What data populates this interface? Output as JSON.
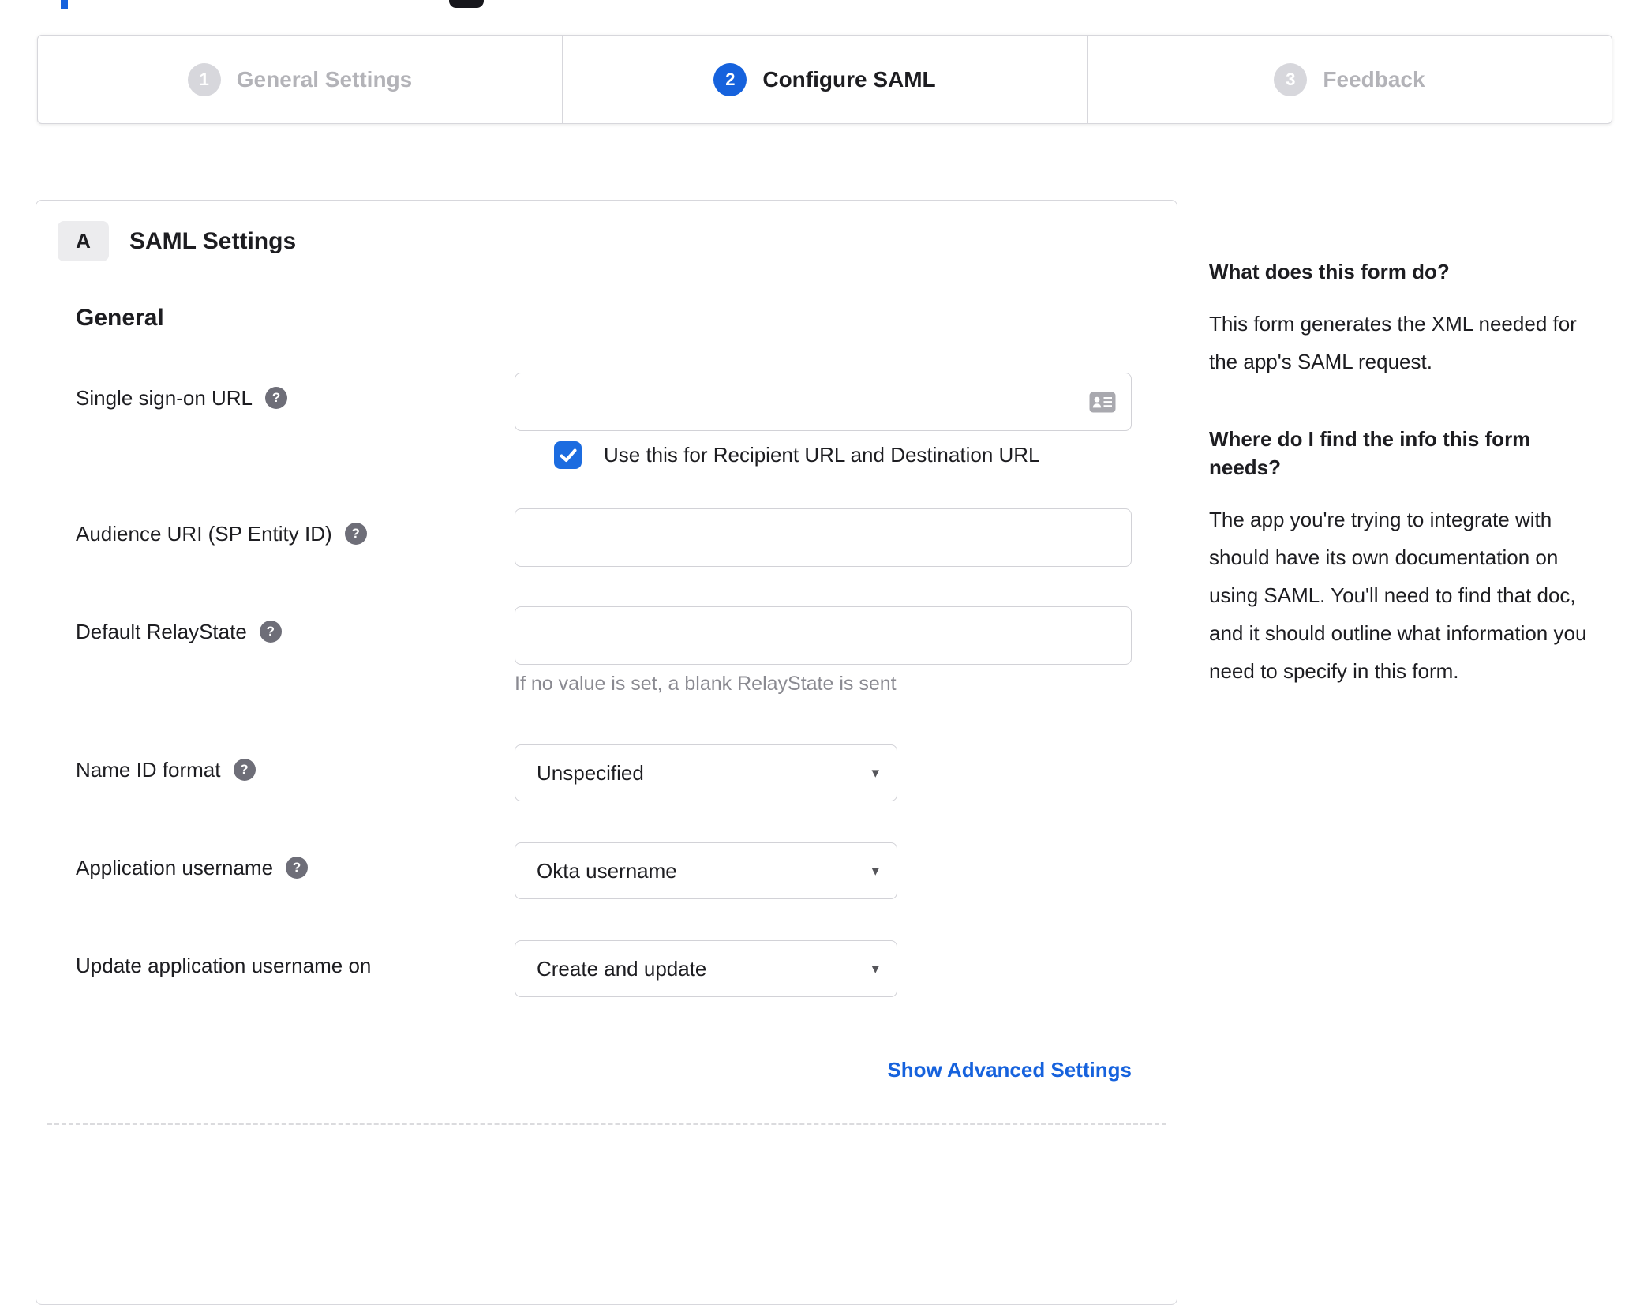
{
  "stepper": {
    "steps": [
      {
        "number": "1",
        "label": "General Settings",
        "state": "inactive"
      },
      {
        "number": "2",
        "label": "Configure SAML",
        "state": "active"
      },
      {
        "number": "3",
        "label": "Feedback",
        "state": "inactive"
      }
    ]
  },
  "panel": {
    "section_badge": "A",
    "section_title": "SAML Settings",
    "group_heading": "General",
    "fields": {
      "sso": {
        "label": "Single sign-on URL",
        "value": "",
        "checkbox_label": "Use this for Recipient URL and Destination URL",
        "checkbox_checked": true
      },
      "audience": {
        "label": "Audience URI (SP Entity ID)",
        "value": ""
      },
      "relay": {
        "label": "Default RelayState",
        "value": "",
        "hint": "If no value is set, a blank RelayState is sent"
      },
      "name_id": {
        "label": "Name ID format",
        "value": "Unspecified"
      },
      "app_username": {
        "label": "Application username",
        "value": "Okta username"
      },
      "update_on": {
        "label": "Update application username on",
        "value": "Create and update"
      }
    },
    "advanced_link": "Show Advanced Settings"
  },
  "sidebar": {
    "blocks": [
      {
        "heading": "What does this form do?",
        "body": "This form generates the XML needed for the app's SAML request."
      },
      {
        "heading": "Where do I find the info this form needs?",
        "body": "The app you're trying to integrate with should have its own documentation on using SAML. You'll need to find that doc, and it should outline what information you need to specify in this form."
      }
    ]
  },
  "glyphs": {
    "help": "?",
    "caret": "▾"
  },
  "icons": [
    "help-icon",
    "contact-card-icon",
    "checkmark-icon",
    "caret-down-icon"
  ],
  "colors": {
    "accent": "#1662dd",
    "checkbox": "#1c6ce0",
    "border": "#d7d7dc",
    "inactive_step_text": "#b3b3b8",
    "hint_text": "#8a8a91",
    "text": "#1d1d21"
  }
}
